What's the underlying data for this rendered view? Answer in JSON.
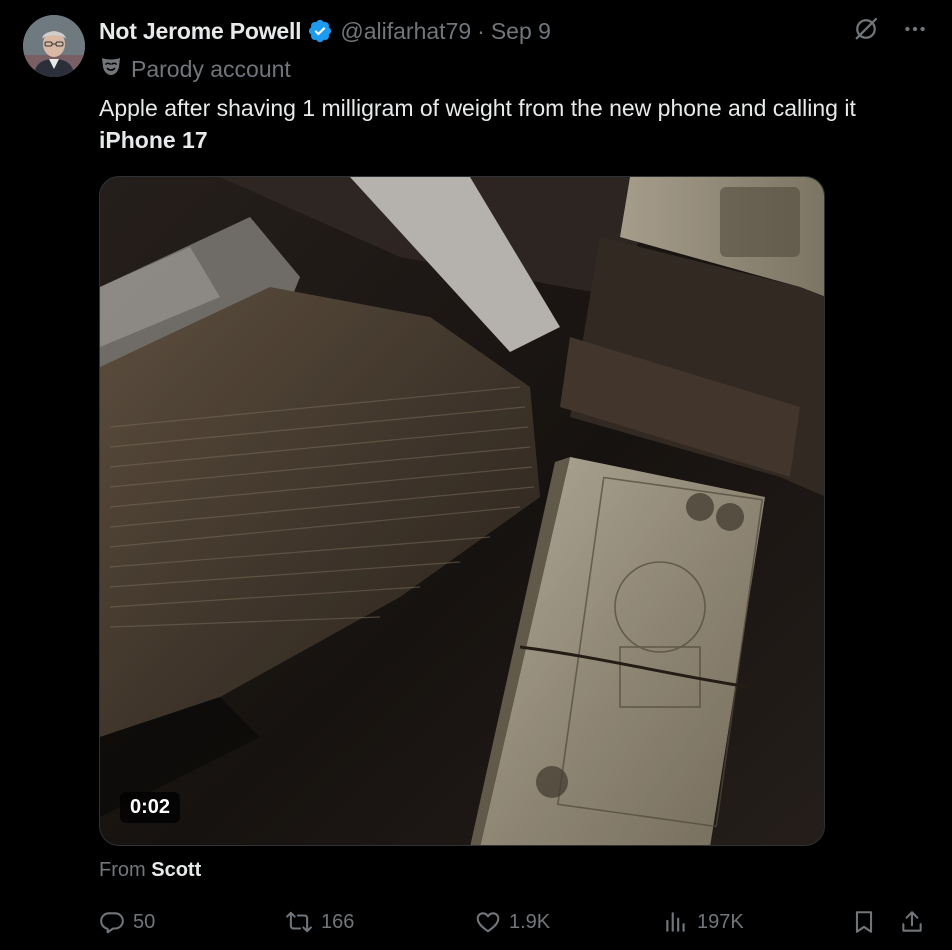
{
  "author": {
    "display_name": "Not Jerome Powell",
    "verified_icon": "verified-badge-icon",
    "handle": "@alifarhat79",
    "separator": "·",
    "date": "Sep 9",
    "label": "Parody account",
    "label_icon": "parody-mask-icon"
  },
  "tweet": {
    "text_line1": "Apple after shaving 1 milligram of weight from the new phone and calling it",
    "text_line2": "iPhone 17"
  },
  "media": {
    "video_time": "0:02"
  },
  "attribution": {
    "prefix": "From",
    "name": "Scott"
  },
  "actions": {
    "replies": "50",
    "reposts": "166",
    "likes": "1.9K",
    "views": "197K"
  },
  "colors": {
    "background": "#000000",
    "text_primary": "#e7e9ea",
    "text_secondary": "#71767b",
    "verified_blue": "#1d9bf0"
  }
}
